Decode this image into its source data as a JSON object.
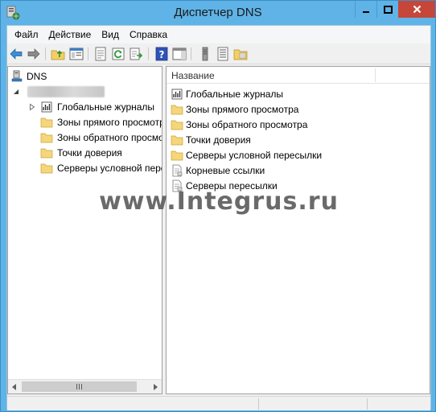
{
  "window": {
    "title": "Диспетчер DNS",
    "controls": [
      "minimize-icon",
      "maximize-icon",
      "close-icon"
    ]
  },
  "menu": {
    "items": [
      "Файл",
      "Действие",
      "Вид",
      "Справка"
    ]
  },
  "toolbar": {
    "buttons": [
      "back-arrow-icon",
      "forward-arrow-icon",
      "up-folder-icon",
      "show-hide-tree-icon",
      "properties-icon",
      "refresh-icon",
      "export-list-icon",
      "help-icon",
      "action-pane-icon",
      "server-icon",
      "record-icon",
      "folder-zones-icon"
    ]
  },
  "tree": {
    "root": "DNS",
    "nodes": [
      "Глобальные журналы",
      "Зоны прямого просмотра",
      "Зоны обратного просмотра",
      "Точки доверия",
      "Серверы условной пересылки"
    ]
  },
  "list": {
    "column_name": "Название",
    "items": [
      "Глобальные журналы",
      "Зоны прямого просмотра",
      "Зоны обратного просмотра",
      "Точки доверия",
      "Серверы условной пересылки",
      "Корневые ссылки",
      "Серверы пересылки"
    ]
  },
  "watermark": "www.Integrus.ru",
  "colors": {
    "titlebar": "#5fb3e6",
    "close_button": "#c7463a",
    "folder": "#f5d67a"
  }
}
